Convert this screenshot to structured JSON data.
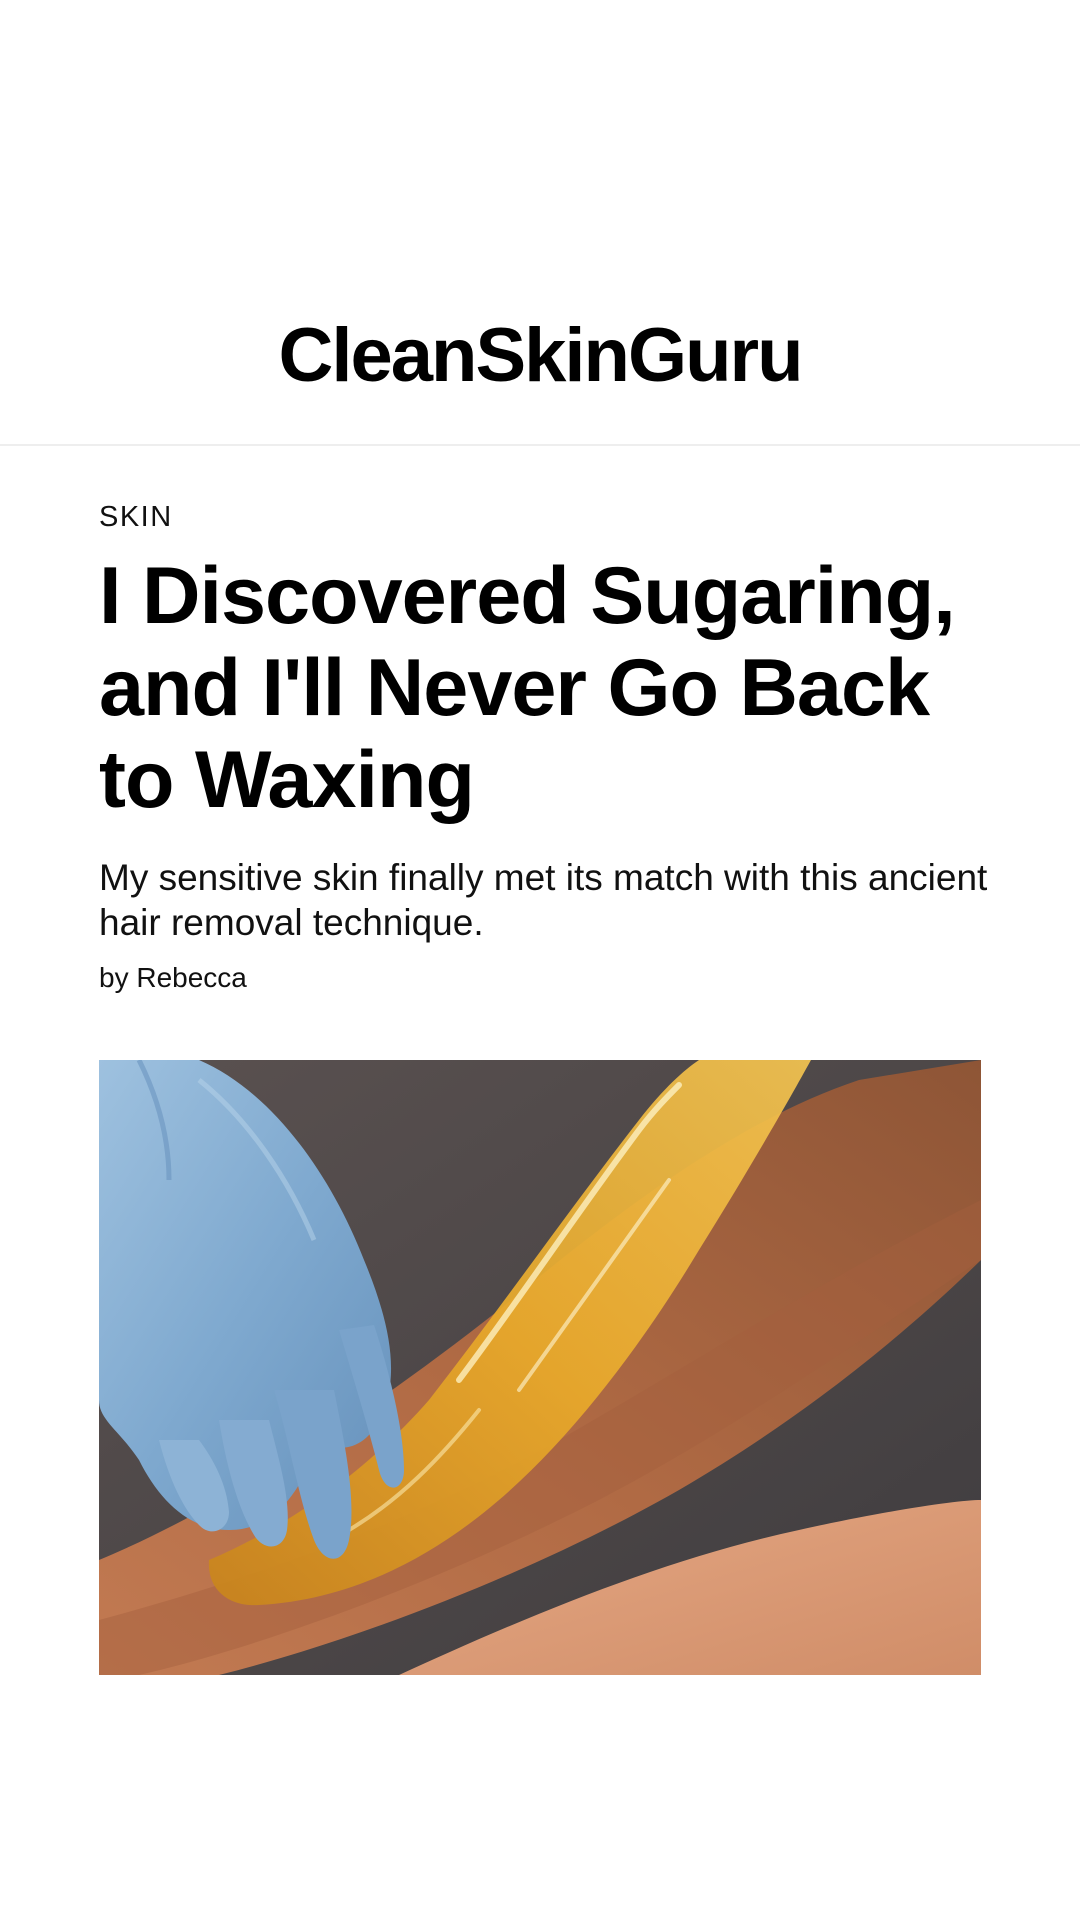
{
  "site": {
    "logo": "CleanSkinGuru"
  },
  "article": {
    "category": "SKIN",
    "headline": "I Discovered Sugaring, and I'll Never Go Back to Waxing",
    "dek": "My sensitive skin finally met its match with this ancient hair removal technique.",
    "byline_prefix": "by ",
    "author": "Rebecca"
  },
  "hero_image": {
    "alt": "Gloved hand applying sugaring paste to a leg"
  }
}
